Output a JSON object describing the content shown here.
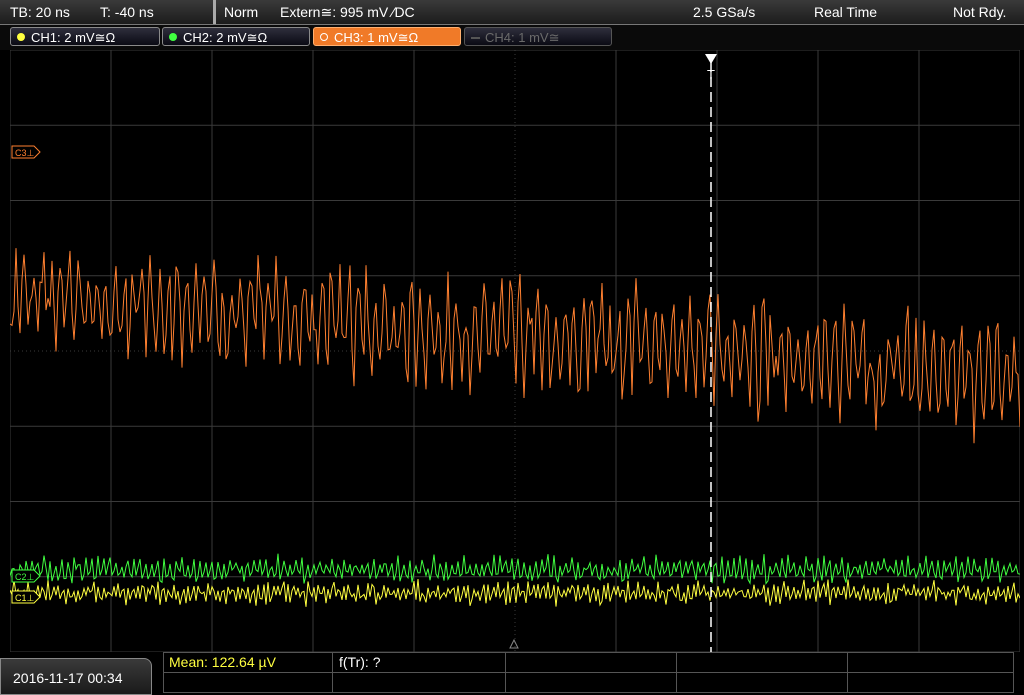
{
  "topbar": {
    "timebase": "TB: 20 ns",
    "trigger_time": "T: -40 ns",
    "mode": "Norm",
    "trigger_source": "Extern≅: 995 mV ∕DC",
    "sample_rate": "2.5 GSa/s",
    "acq_mode": "Real Time",
    "status": "Not Rdy."
  },
  "channels": [
    {
      "label": "CH1: 2 mV≅Ω",
      "color": "#ffff40",
      "state": "on"
    },
    {
      "label": "CH2: 2 mV≅Ω",
      "color": "#40ff40",
      "state": "on"
    },
    {
      "label": "CH3: 1 mV≅Ω",
      "color": "#ff8030",
      "state": "active"
    },
    {
      "label": "CH4: 1 mV≅",
      "color": "#666666",
      "state": "off"
    }
  ],
  "markers": {
    "ch3": "C3⊥",
    "ch2": "C2⊥",
    "ch1": "C1⊥",
    "trigger": "T"
  },
  "measurements": {
    "mean": "Mean: 122.64 µV",
    "freq": "f(Tr): ?"
  },
  "datetime": "2016-11-17 00:34",
  "colors": {
    "ch1": "#ffff40",
    "ch2": "#40ff40",
    "ch3": "#ff8030",
    "grid": "#3a3a3a"
  }
}
